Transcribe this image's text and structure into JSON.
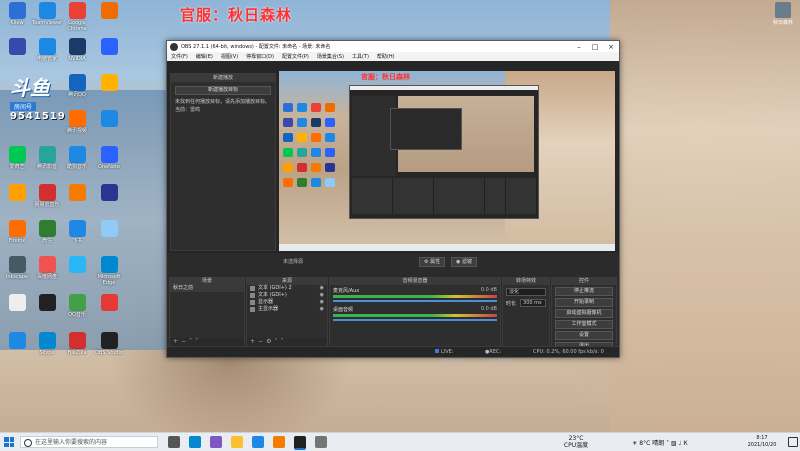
{
  "watermark": "官服：秋日森林",
  "stream_logo": {
    "brand": "斗鱼",
    "tag": "房间号",
    "room": "9541519"
  },
  "user": {
    "name": "秋日森林"
  },
  "desktop_icons": [
    {
      "label": "Kliew",
      "color": "#2d6fd6"
    },
    {
      "label": "TeamViewer",
      "color": "#1e88e5"
    },
    {
      "label": "Google Chrome",
      "color": "#e94235"
    },
    {
      "label": "",
      "color": "#ef6c00"
    },
    {
      "label": "",
      "color": "#3949ab"
    },
    {
      "label": "电脑管家",
      "color": "#1e88e5"
    },
    {
      "label": "NVIDIA",
      "color": "#1a3a6a"
    },
    {
      "label": "",
      "color": "#2962ff"
    },
    {
      "label": "腾讯QQ",
      "color": "#1565c0"
    },
    {
      "label": "",
      "color": "#ffb300"
    },
    {
      "label": "腾讯视频",
      "color": "#ff6d00"
    },
    {
      "label": "",
      "color": "#1e88e5"
    },
    {
      "label": "爱奇艺",
      "color": "#00c853"
    },
    {
      "label": "腾讯影音",
      "color": "#26a69a"
    },
    {
      "label": "酷狗音乐",
      "color": "#1e88e5"
    },
    {
      "label": "OneNote",
      "color": "#2962ff"
    },
    {
      "label": "",
      "color": "#ffa000"
    },
    {
      "label": "网易云音乐",
      "color": "#d32f2f"
    },
    {
      "label": "",
      "color": "#f57c00"
    },
    {
      "label": "",
      "color": "#283593"
    },
    {
      "label": "Firefox",
      "color": "#ff6d00"
    },
    {
      "label": "微信",
      "color": "#2e7d32"
    },
    {
      "label": "飞书",
      "color": "#1e88e5"
    },
    {
      "label": "",
      "color": "#90caf9"
    },
    {
      "label": "Inkscape",
      "color": "#455a64"
    },
    {
      "label": "百度网盘",
      "color": "#ef5350"
    },
    {
      "label": "",
      "color": "#29b6f6"
    },
    {
      "label": "Microsoft Edge",
      "color": "#0288d1"
    },
    {
      "label": "",
      "color": "#eeeeee"
    },
    {
      "label": "",
      "color": "#212121"
    },
    {
      "label": "QQ音乐",
      "color": "#43a047"
    },
    {
      "label": "",
      "color": "#e53935"
    },
    {
      "label": "",
      "color": "#1e88e5"
    },
    {
      "label": "Skype",
      "color": "#0288d1"
    },
    {
      "label": "FileZilla",
      "color": "#d32f2f"
    },
    {
      "label": "OBS Studio",
      "color": "#212121"
    }
  ],
  "obs": {
    "title": "OBS 27.1.1 (64-bit, windows) - 配置文件: 未命名 - 场景: 未命名",
    "menu": [
      "文件(F)",
      "编辑(E)",
      "视图(V)",
      "停靠窗口(D)",
      "配置文件(P)",
      "场景集合(S)",
      "工具(T)",
      "帮助(H)"
    ],
    "left_panel": {
      "header": "新建播放",
      "button": "新建播放目标",
      "text_line1": "未找到任何播放目标，请先添加播放目标。",
      "text_line2": "当前：雷鸣"
    },
    "current_source": "未选择源",
    "preview_buttons": {
      "properties": "属性",
      "filters": "滤镜"
    },
    "docks": {
      "scenes": {
        "header": "场景",
        "items": [
          "秋日之前"
        ]
      },
      "sources": {
        "header": "来源",
        "items": [
          "文本 (GDI+) 2",
          "文本 (GDI+)",
          "显示器",
          "主显示器"
        ]
      },
      "mixer": {
        "header": "音频混音器",
        "channels": [
          {
            "name": "桌面音频",
            "level": "0.0 dB"
          },
          {
            "name": "麦克风/Aux",
            "level": "0.0 dB"
          }
        ]
      },
      "transitions": {
        "header": "转场特效",
        "type": "淡化",
        "duration_label": "时长",
        "duration_value": "300 ms"
      },
      "controls": {
        "header": "控件",
        "buttons": [
          "停止推流",
          "开始录制",
          "启动虚拟摄像机",
          "工作室模式",
          "设置",
          "退出"
        ]
      }
    },
    "status": {
      "live": "LIVE: 00:00:00",
      "rec": "REC: 00:00:00",
      "cpu": "CPU: 0.2%, 60.00 fps",
      "net": "kb/s: 0"
    }
  },
  "taskbar": {
    "search_placeholder": "在这里输入你要搜索的内容",
    "apps": [
      {
        "name": "task-view",
        "color": "#555555"
      },
      {
        "name": "edge",
        "color": "#0288d1"
      },
      {
        "name": "store",
        "color": "#7e57c2"
      },
      {
        "name": "explorer",
        "color": "#fbc02d"
      },
      {
        "name": "lark",
        "color": "#1e88e5"
      },
      {
        "name": "app-orange",
        "color": "#f57c00"
      },
      {
        "name": "obs",
        "color": "#212121"
      },
      {
        "name": "app-grey",
        "color": "#757575"
      }
    ],
    "weather_temp": "23°C",
    "weather_desc": "CPU温度",
    "tray_text": "8°C 晴朗",
    "time": "8:17",
    "date": "2021/10/20"
  }
}
